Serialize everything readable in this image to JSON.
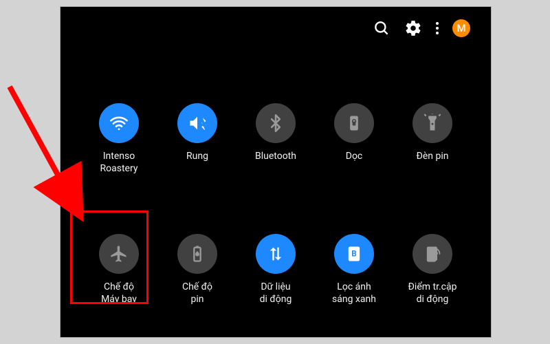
{
  "topbar": {
    "avatar_initial": "M"
  },
  "tiles": {
    "wifi": {
      "label": "Intenso\nRoastery",
      "active": true
    },
    "sound": {
      "label": "Rung",
      "active": true
    },
    "bluetooth": {
      "label": "Bluetooth",
      "active": false
    },
    "rotation": {
      "label": "Dọc",
      "active": false
    },
    "flashlight": {
      "label": "Đèn pin",
      "active": false
    },
    "airplane": {
      "label": "Chế độ\nMáy bay",
      "active": false
    },
    "battery": {
      "label": "Chế độ\npin",
      "active": false
    },
    "mobiledata": {
      "label": "Dữ liệu\ndi động",
      "active": true
    },
    "bluelight": {
      "label": "Lọc ánh\nsáng xanh",
      "active": true
    },
    "hotspot": {
      "label": "Điểm tr.cập\ndi động",
      "active": false
    }
  },
  "colors": {
    "accent": "#1E88FF",
    "inactive_tile": "#414141",
    "avatar": "#FF8C00",
    "highlight": "#ff0000"
  }
}
